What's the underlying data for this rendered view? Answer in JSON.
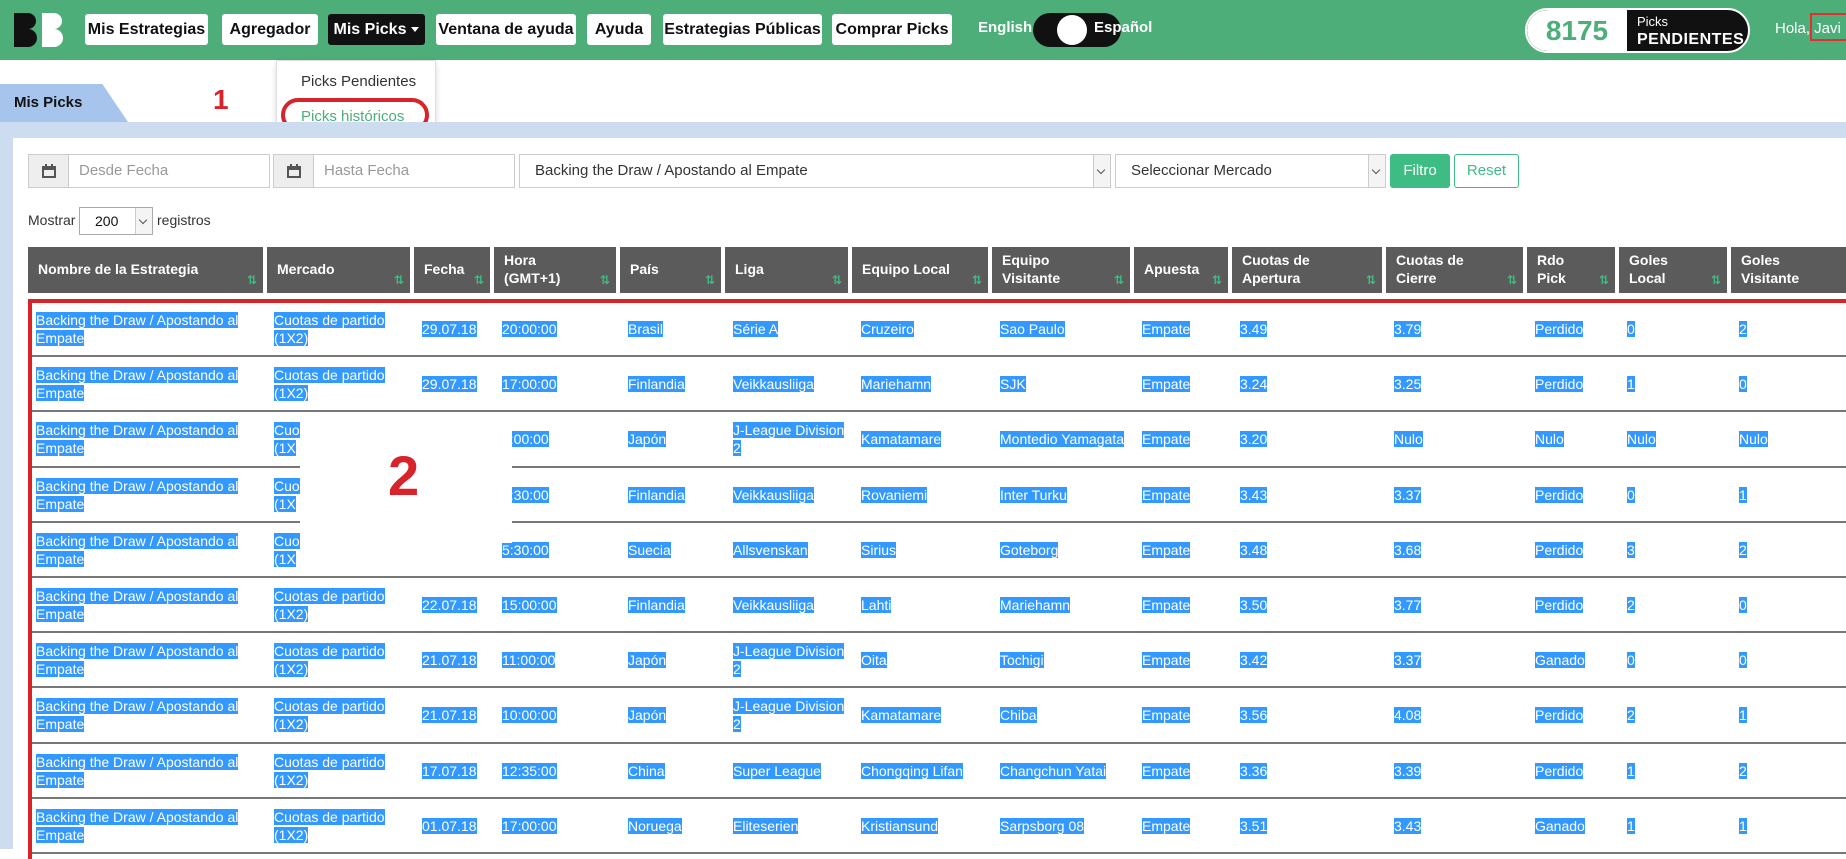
{
  "nav": {
    "items": [
      {
        "label": "Mis Estrategias"
      },
      {
        "label": "Agregador"
      },
      {
        "label": "Mis Picks"
      },
      {
        "label": "Ventana de ayuda"
      },
      {
        "label": "Ayuda"
      },
      {
        "label": "Estrategias Públicas"
      },
      {
        "label": "Comprar Picks"
      }
    ],
    "lang_en": "English",
    "lang_es": "Español",
    "pending_count": "8175",
    "pending_small": "Picks",
    "pending_big": "PENDIENTES",
    "greeting": "Hola, Javi P"
  },
  "dropdown": {
    "items": [
      "Picks Pendientes",
      "Picks históricos"
    ]
  },
  "tab": "Mis Picks",
  "annotations": {
    "one": "1",
    "two": "2"
  },
  "filters": {
    "desde": "Desde Fecha",
    "hasta": "Hasta Fecha",
    "strategy": "Backing the Draw / Apostando al Empate",
    "market": "Seleccionar Mercado",
    "filtro": "Filtro",
    "reset": "Reset",
    "show_pre": "Mostrar",
    "show_value": "200",
    "show_post": "registros"
  },
  "table": {
    "headers": [
      [
        "Nombre de la Estrategia"
      ],
      [
        "Mercado"
      ],
      [
        "Fecha"
      ],
      [
        "Hora",
        "(GMT+1)"
      ],
      [
        "País"
      ],
      [
        "Liga"
      ],
      [
        "Equipo Local"
      ],
      [
        "Equipo",
        "Visitante"
      ],
      [
        "Apuesta"
      ],
      [
        "Cuotas de",
        "Apertura"
      ],
      [
        "Cuotas de",
        "Cierre"
      ],
      [
        "Rdo",
        "Pick"
      ],
      [
        "Goles",
        "Local"
      ],
      [
        "Goles",
        "Visitante"
      ]
    ],
    "rows": [
      [
        [
          "Backing the Draw / Apostando al",
          "Empate"
        ],
        [
          "Cuotas de partido",
          "(1X2)"
        ],
        [
          "29.07.18"
        ],
        [
          "20:00:00"
        ],
        [
          "Brasil"
        ],
        [
          "Série A"
        ],
        [
          "Cruzeiro"
        ],
        [
          "Sao Paulo"
        ],
        [
          "Empate"
        ],
        [
          "3.49"
        ],
        [
          "3.79"
        ],
        [
          "Perdido"
        ],
        [
          "0"
        ],
        [
          "2"
        ]
      ],
      [
        [
          "Backing the Draw / Apostando al",
          "Empate"
        ],
        [
          "Cuotas de partido",
          "(1X2)"
        ],
        [
          "29.07.18"
        ],
        [
          "17:00:00"
        ],
        [
          "Finlandia"
        ],
        [
          "Veikkausliiga"
        ],
        [
          "Mariehamn"
        ],
        [
          "SJK"
        ],
        [
          "Empate"
        ],
        [
          "3.24"
        ],
        [
          "3.25"
        ],
        [
          "Perdido"
        ],
        [
          "1"
        ],
        [
          "0"
        ]
      ],
      [
        [
          "Backing the Draw / Apostando al",
          "Empate"
        ],
        [
          "Cuo",
          "(1X"
        ],
        [
          ""
        ],
        [
          "0:00:00"
        ],
        [
          "Japón"
        ],
        [
          "J-League Division",
          "2"
        ],
        [
          "Kamatamare"
        ],
        [
          "Montedio Yamagata"
        ],
        [
          "Empate"
        ],
        [
          "3.20"
        ],
        [
          "Nulo"
        ],
        [
          "Nulo"
        ],
        [
          "Nulo"
        ],
        [
          "Nulo"
        ]
      ],
      [
        [
          "Backing the Draw / Apostando al",
          "Empate"
        ],
        [
          "Cuo",
          "(1X"
        ],
        [
          ""
        ],
        [
          "5:30:00"
        ],
        [
          "Finlandia"
        ],
        [
          "Veikkausliiga"
        ],
        [
          "Rovaniemi"
        ],
        [
          "Inter Turku"
        ],
        [
          "Empate"
        ],
        [
          "3.43"
        ],
        [
          "3.37"
        ],
        [
          "Perdido"
        ],
        [
          "0"
        ],
        [
          "1"
        ]
      ],
      [
        [
          "Backing the Draw / Apostando al",
          "Empate"
        ],
        [
          "Cuo",
          "(1X"
        ],
        [
          ""
        ],
        [
          "5:30:00"
        ],
        [
          "Suecia"
        ],
        [
          "Allsvenskan"
        ],
        [
          "Sirius"
        ],
        [
          "Goteborg"
        ],
        [
          "Empate"
        ],
        [
          "3.48"
        ],
        [
          "3.68"
        ],
        [
          "Perdido"
        ],
        [
          "3"
        ],
        [
          "2"
        ]
      ],
      [
        [
          "Backing the Draw / Apostando al",
          "Empate"
        ],
        [
          "Cuotas de partido",
          "(1X2)"
        ],
        [
          "22.07.18"
        ],
        [
          "15:00:00"
        ],
        [
          "Finlandia"
        ],
        [
          "Veikkausliiga"
        ],
        [
          "Lahti"
        ],
        [
          "Mariehamn"
        ],
        [
          "Empate"
        ],
        [
          "3.50"
        ],
        [
          "3.77"
        ],
        [
          "Perdido"
        ],
        [
          "2"
        ],
        [
          "0"
        ]
      ],
      [
        [
          "Backing the Draw / Apostando al",
          "Empate"
        ],
        [
          "Cuotas de partido",
          "(1X2)"
        ],
        [
          "21.07.18"
        ],
        [
          "11:00:00"
        ],
        [
          "Japón"
        ],
        [
          "J-League Division",
          "2"
        ],
        [
          "Oita"
        ],
        [
          "Tochigi"
        ],
        [
          "Empate"
        ],
        [
          "3.42"
        ],
        [
          "3.37"
        ],
        [
          "Ganado"
        ],
        [
          "0"
        ],
        [
          "0"
        ]
      ],
      [
        [
          "Backing the Draw / Apostando al",
          "Empate"
        ],
        [
          "Cuotas de partido",
          "(1X2)"
        ],
        [
          "21.07.18"
        ],
        [
          "10:00:00"
        ],
        [
          "Japón"
        ],
        [
          "J-League Division",
          "2"
        ],
        [
          "Kamatamare"
        ],
        [
          "Chiba"
        ],
        [
          "Empate"
        ],
        [
          "3.56"
        ],
        [
          "4.08"
        ],
        [
          "Perdido"
        ],
        [
          "2"
        ],
        [
          "1"
        ]
      ],
      [
        [
          "Backing the Draw / Apostando al",
          "Empate"
        ],
        [
          "Cuotas de partido",
          "(1X2)"
        ],
        [
          "17.07.18"
        ],
        [
          "12:35:00"
        ],
        [
          "China"
        ],
        [
          "Super League"
        ],
        [
          "Chongqing Lifan"
        ],
        [
          "Changchun Yatai"
        ],
        [
          "Empate"
        ],
        [
          "3.36"
        ],
        [
          "3.39"
        ],
        [
          "Perdido"
        ],
        [
          "1"
        ],
        [
          "2"
        ]
      ],
      [
        [
          "Backing the Draw / Apostando al",
          "Empate"
        ],
        [
          "Cuotas de partido",
          "(1X2)"
        ],
        [
          "01.07.18"
        ],
        [
          "17:00:00"
        ],
        [
          "Noruega"
        ],
        [
          "Eliteserien"
        ],
        [
          "Kristiansund"
        ],
        [
          "Sarpsborg 08"
        ],
        [
          "Empate"
        ],
        [
          "3.51"
        ],
        [
          "3.43"
        ],
        [
          "Ganado"
        ],
        [
          "1"
        ],
        [
          "1"
        ]
      ]
    ]
  },
  "colors": {
    "brand": "#4dae7a",
    "selection": "#3399ff",
    "annotation": "#d8232a"
  }
}
